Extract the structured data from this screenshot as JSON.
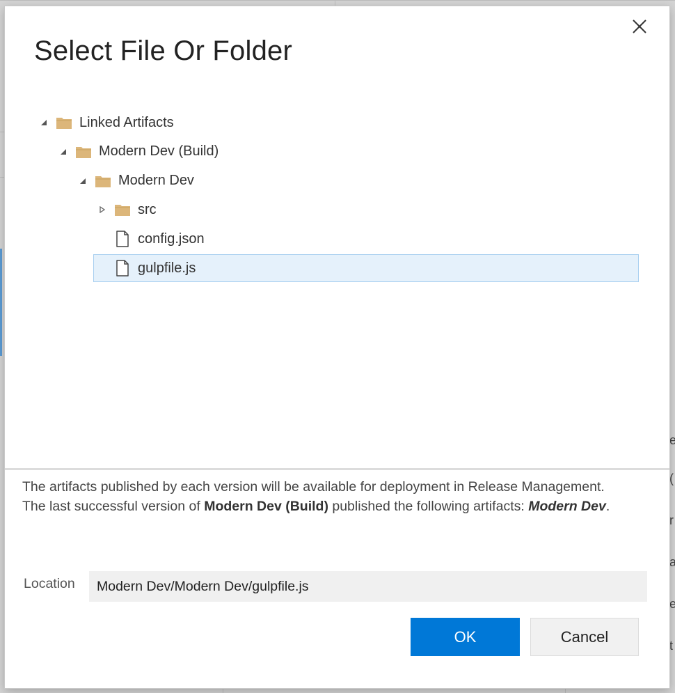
{
  "background": {
    "side_chars": [
      "e",
      "(",
      "r",
      "a",
      "e",
      "t"
    ]
  },
  "dialog": {
    "title": "Select File Or Folder",
    "close_label": "Close"
  },
  "tree": [
    {
      "label": "Linked Artifacts",
      "type": "folder",
      "expanded": true,
      "level": 0
    },
    {
      "label": "Modern Dev (Build)",
      "type": "folder",
      "expanded": true,
      "level": 1
    },
    {
      "label": "Modern Dev",
      "type": "folder",
      "expanded": true,
      "level": 2
    },
    {
      "label": "src",
      "type": "folder",
      "expanded": false,
      "level": 3
    },
    {
      "label": "config.json",
      "type": "file",
      "level": 3
    },
    {
      "label": "gulpfile.js",
      "type": "file",
      "level": 3,
      "selected": true
    }
  ],
  "info": {
    "part1": "The artifacts published by each version will be available for deployment in Release Management. The last successful version of ",
    "build_name": "Modern Dev (Build)",
    "part2": " published the following artifacts: ",
    "artifact_name": "Modern Dev",
    "part3": "."
  },
  "location": {
    "label": "Location",
    "value": "Modern Dev/Modern Dev/gulpfile.js"
  },
  "buttons": {
    "ok": "OK",
    "cancel": "Cancel"
  },
  "colors": {
    "primary": "#0078d7",
    "folder": "#dcb67a",
    "selection_bg": "#e5f1fb",
    "selection_border": "#a9d0f0"
  }
}
